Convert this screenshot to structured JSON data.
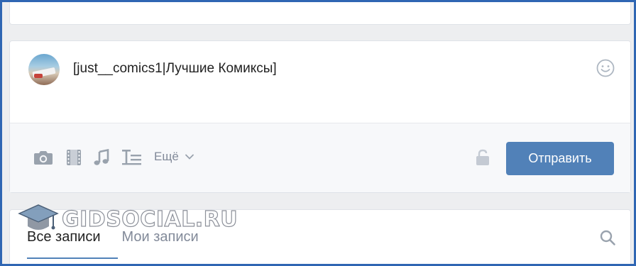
{
  "composer": {
    "text": "[just__comics1|Лучшие Комиксы]",
    "more_label": "Ещё",
    "send_label": "Отправить"
  },
  "feed": {
    "tabs": [
      "Все записи",
      "Мои записи"
    ]
  },
  "watermark": {
    "text": "GIDSOCIAL.RU"
  },
  "icons": [
    "emoji-icon",
    "camera-icon",
    "video-icon",
    "music-icon",
    "article-icon",
    "chevron-down-icon",
    "lock-icon",
    "search-icon",
    "graduation-cap-icon"
  ],
  "colors": {
    "frame_border": "#2f66b3",
    "accent": "#5181b8",
    "icon_gray": "#99a2ad",
    "background": "#edeef0"
  }
}
